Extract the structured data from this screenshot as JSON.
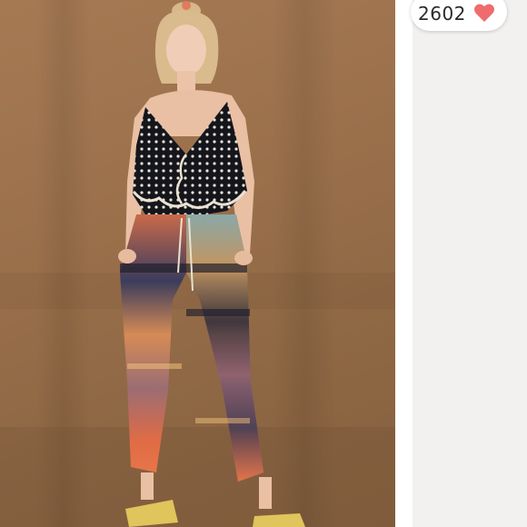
{
  "listing": {
    "like_count": "2602",
    "like_icon": "heart-icon",
    "like_icon_color": "#f06b6b"
  },
  "photo": {
    "subject": "product-photo",
    "backdrop_color": "#9a704b"
  }
}
